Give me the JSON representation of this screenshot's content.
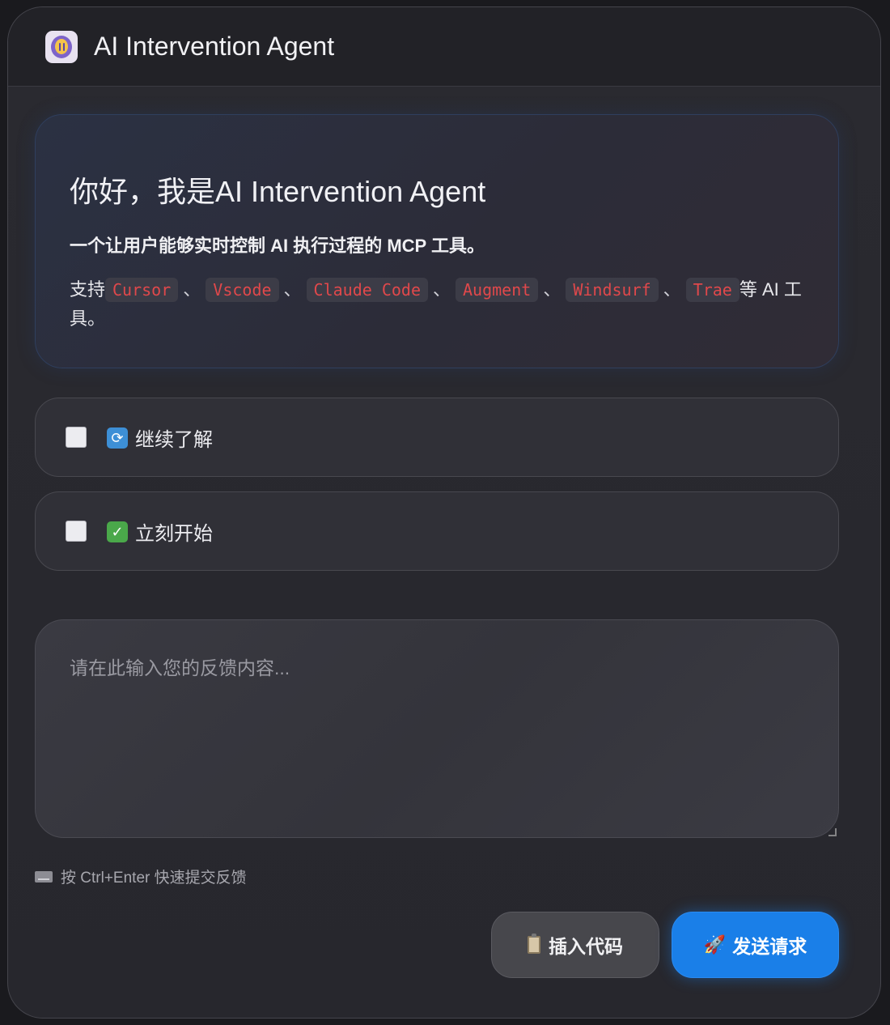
{
  "window": {
    "title": "AI Intervention Agent",
    "icon": "app-logo-icon"
  },
  "hero": {
    "heading": "你好，我是AI Intervention Agent",
    "subtitle": "一个让用户能够实时控制 AI 执行过程的 MCP 工具。",
    "support_prefix": "支持",
    "tools": [
      "Cursor",
      "Vscode",
      "Claude Code",
      "Augment",
      "Windsurf",
      "Trae"
    ],
    "separator": "、",
    "support_suffix": "等 AI 工具。"
  },
  "options": [
    {
      "label": "继续了解",
      "icon": "cycle-arrows-icon",
      "checked": false
    },
    {
      "label": "立刻开始",
      "icon": "check-mark-icon",
      "checked": false
    }
  ],
  "feedback": {
    "placeholder": "请在此输入您的反馈内容...",
    "value": ""
  },
  "hint": {
    "text": "按 Ctrl+Enter 快速提交反馈",
    "icon": "keyboard-icon"
  },
  "buttons": {
    "insert_code": {
      "label": "插入代码",
      "icon": "clipboard-icon"
    },
    "send_request": {
      "label": "发送请求",
      "icon": "rocket-icon"
    }
  },
  "colors": {
    "background": "#1a1a1e",
    "accent": "#1a7fe8",
    "code_text": "#e0484b"
  }
}
